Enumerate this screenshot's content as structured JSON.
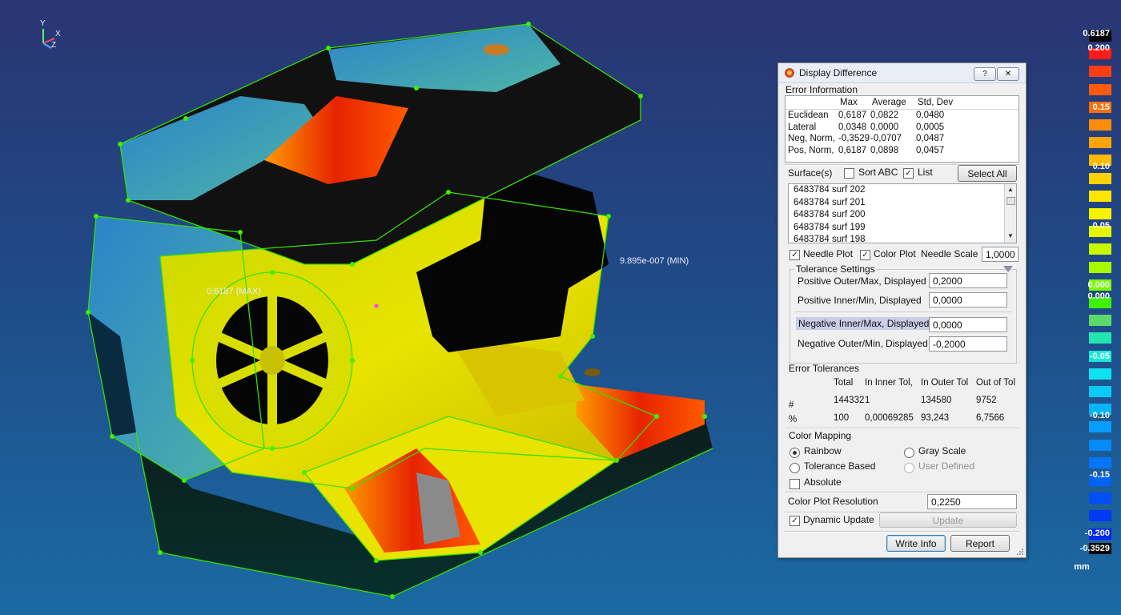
{
  "viewport": {
    "max_label": "0.6187 (MAX)",
    "min_label": "9.895e-007 (MIN)",
    "axis": {
      "x": "X",
      "y": "Y",
      "z": "Z"
    }
  },
  "legend": {
    "unit": "mm",
    "ticks": [
      "0.6187",
      "0.200",
      "0.15",
      "0.10",
      "0.05",
      "0.000",
      "0.000",
      "-0.05",
      "-0.10",
      "-0.15",
      "-0.200",
      "-0.3529"
    ],
    "colors": [
      "#000000",
      "#ff1a1a",
      "#ff3d12",
      "#ff5a0e",
      "#ff700a",
      "#ff8c08",
      "#ffa306",
      "#ffbb04",
      "#ffd202",
      "#ffe600",
      "#f7f200",
      "#e4f600",
      "#c9f800",
      "#a8fa00",
      "#78fb00",
      "#3ef200",
      "#5dd86a",
      "#22e6b0",
      "#16e8d8",
      "#0fe2ef",
      "#0ac9f5",
      "#08b4f7",
      "#069ef8",
      "#058af8",
      "#0476f7",
      "#0462f6",
      "#034ef5",
      "#023af4",
      "#0226f3",
      "#000000"
    ]
  },
  "dialog": {
    "title": "Display Difference",
    "help_btn": "?",
    "close_btn": "✕",
    "error_info": {
      "label": "Error Information",
      "headers": [
        "Max",
        "Average",
        "Std, Dev"
      ],
      "rows": [
        {
          "name": "Euclidean",
          "max": "0,6187",
          "avg": "0,0822",
          "std": "0,0480"
        },
        {
          "name": "Lateral",
          "max": "0,0348",
          "avg": "0,0000",
          "std": "0,0005"
        },
        {
          "name": "Neg, Norm,",
          "max": "-0,3529",
          "avg": "-0,0707",
          "std": "0,0487"
        },
        {
          "name": "Pos, Norm,",
          "max": "0,6187",
          "avg": "0,0898",
          "std": "0,0457"
        }
      ]
    },
    "surfaces": {
      "label": "Surface(s)",
      "sort_abc": "Sort ABC",
      "list": "List",
      "select_all": "Select All",
      "items": [
        "6483784 surf 202",
        "6483784 surf 201",
        "6483784 surf 200",
        "6483784 surf 199",
        "6483784 surf 198"
      ]
    },
    "plot": {
      "needle_plot": "Needle Plot",
      "color_plot": "Color Plot",
      "needle_scale_label": "Needle Scale",
      "needle_scale": "1,0000"
    },
    "tolerance": {
      "label": "Tolerance Settings",
      "pos_outer_label": "Positive Outer/Max, Displayed",
      "pos_outer": "0,2000",
      "pos_inner_label": "Positive Inner/Min, Displayed",
      "pos_inner": "0,0000",
      "neg_inner_label": "Negative Inner/Max, Displayed",
      "neg_inner": "0,0000",
      "neg_outer_label": "Negative Outer/Min, Displayed",
      "neg_outer": "-0,2000"
    },
    "error_tol": {
      "label": "Error Tolerances",
      "headers": [
        "Total",
        "In Inner Tol,",
        "In Outer Tol",
        "Out of Tol"
      ],
      "count_label": "#",
      "count": [
        "144332",
        "1",
        "134580",
        "9752"
      ],
      "pct_label": "%",
      "pct": [
        "100",
        "0,00069285",
        "93,243",
        "6,7566"
      ]
    },
    "mapping": {
      "label": "Color Mapping",
      "rainbow": "Rainbow",
      "gray": "Gray Scale",
      "tol_based": "Tolerance Based",
      "user_defined": "User Defined",
      "absolute": "Absolute"
    },
    "resolution": {
      "label": "Color Plot Resolution",
      "value": "0,2250"
    },
    "dynamic_update": "Dynamic Update",
    "update": "Update",
    "write_info": "Write Info",
    "report": "Report"
  }
}
